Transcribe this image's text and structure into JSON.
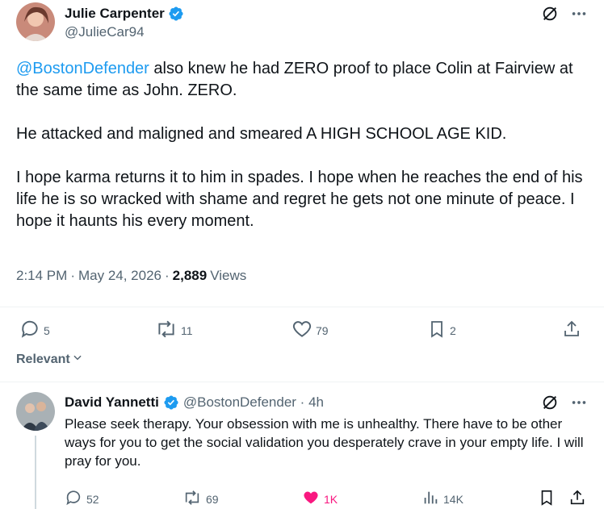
{
  "post": {
    "author_name": "Julie Carpenter",
    "handle": "@JulieCar94",
    "mention": "@BostonDefender",
    "text_p1_rest": " also knew he had ZERO proof to place Colin at Fairview at the same time as John. ZERO.",
    "text_p2": "He attacked and maligned and smeared A HIGH SCHOOL AGE KID.",
    "text_p3": "I hope karma returns it to him in spades. I hope when he reaches the end of his life he is so wracked with shame and regret he gets not one minute of peace. I hope it haunts his every moment.",
    "time": "2:14 PM",
    "sep1": "·",
    "date": "May 24, 2026",
    "sep2": "·",
    "views_count": "2,889",
    "views_label": "Views",
    "replies": "5",
    "reposts": "11",
    "likes": "79",
    "bookmarks": "2"
  },
  "filter": {
    "label": "Relevant"
  },
  "reply": {
    "author_name": "David Yannetti",
    "handle_time": "@BostonDefender · 4h",
    "text": "Please seek therapy. Your obsession with me is unhealthy.  There have to be other ways for you to get the social validation you desperately crave in your empty life. I will pray for you.",
    "replies": "52",
    "reposts": "69",
    "likes": "1K",
    "views": "14K"
  },
  "icons": {
    "verified": "verified-badge-icon",
    "grok": "grok-icon",
    "more": "more-icon",
    "reply": "reply-icon",
    "repost": "repost-icon",
    "like": "heart-icon",
    "bookmark": "bookmark-icon",
    "share": "share-icon",
    "views": "views-icon",
    "chevron": "chevron-down-icon"
  },
  "colors": {
    "link": "#1d9bf0",
    "secondary_text": "#536471",
    "like_active": "#f91880",
    "verified": "#1d9bf0"
  }
}
